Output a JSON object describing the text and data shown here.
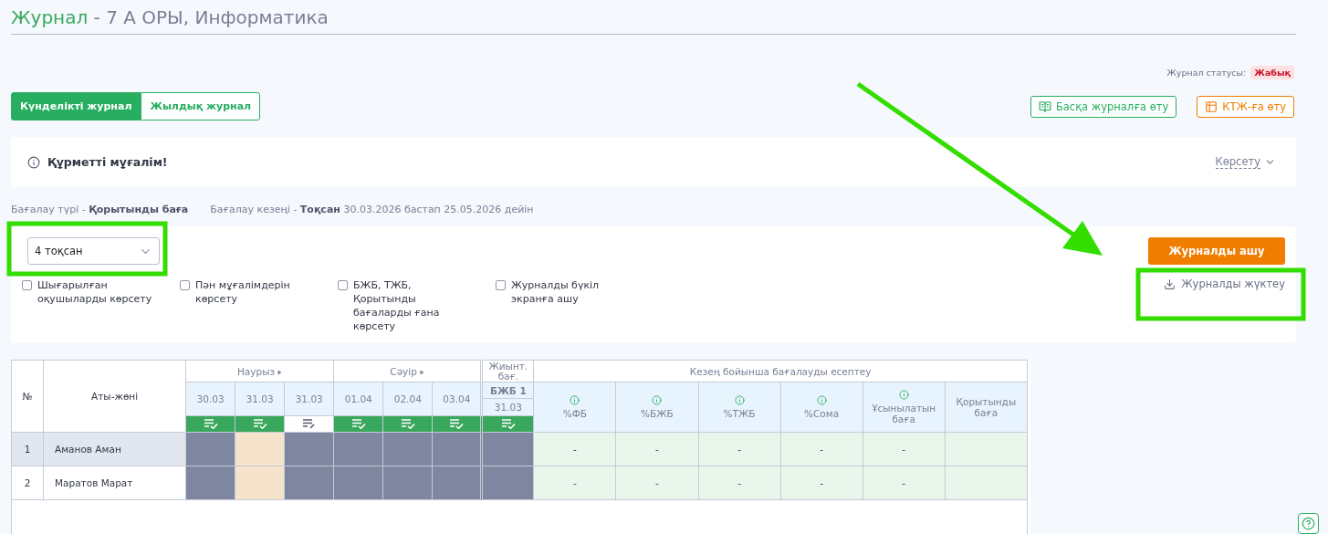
{
  "title": {
    "lead": "Журнал",
    "rest": "- 7 А ОРЫ, Информатика"
  },
  "status": {
    "label": "Журнал статусы:",
    "value": "Жабық"
  },
  "tabs": [
    {
      "label": "Күнделікті журнал",
      "selected": true
    },
    {
      "label": "Жылдық журнал",
      "selected": false
    }
  ],
  "actions": [
    {
      "label": "Басқа журналға өту",
      "kind": "journal"
    },
    {
      "label": "КТЖ-ға өту",
      "kind": "plan"
    }
  ],
  "notice": {
    "text": "Құрметті мұғалім!",
    "toggle": "Көрсету"
  },
  "assessment": [
    "Бағалау түрі - **Қорытынды баға**",
    "Бағалау кезеңі - **Тоқсан** 30.03.2026 бастап 25.05.2026 дейін"
  ],
  "quarter_select": {
    "value": "4 тоқсан"
  },
  "options": [
    {
      "label": "Шығарылған оқушыларды көрсету",
      "checked": false
    },
    {
      "label": "Пән мұғалімдерін көрсету",
      "checked": false
    },
    {
      "label": "БЖБ, ТЖБ, Қорытынды бағаларды ғана көрсету",
      "checked": false
    },
    {
      "label": "Журналды бүкіл экранға ашу",
      "checked": false
    }
  ],
  "open_button": "Журналды ашу",
  "download_link": "Журналды жүктеу",
  "table": {
    "no_header": "№",
    "name_header": "Аты-жөні",
    "months": [
      {
        "label": "Наурыз",
        "dates": [
          {
            "date": "30.03",
            "checked": true
          },
          {
            "date": "31.03",
            "checked": true
          },
          {
            "date": "31.03",
            "checked": false
          }
        ]
      },
      {
        "label": "Сәуір",
        "dates": [
          {
            "date": "01.04",
            "checked": true
          },
          {
            "date": "02.04",
            "checked": true
          },
          {
            "date": "03.04",
            "checked": true
          }
        ]
      }
    ],
    "summative": {
      "header": "Жиынт. бағ.",
      "label": "БЖБ 1",
      "date": "31.03",
      "checked": true
    },
    "calc": {
      "header": "Кезең бойынша бағалауды есептеу",
      "columns": [
        {
          "label": "%ФБ",
          "info": true
        },
        {
          "label": "%БЖБ",
          "info": true
        },
        {
          "label": "%ТЖБ",
          "info": true
        },
        {
          "label": "%Сома",
          "info": true
        },
        {
          "label": "Ұсынылатын баға",
          "info": true
        },
        {
          "label": "Қорытынды баға",
          "info": false
        }
      ]
    },
    "rows": [
      {
        "no": "1",
        "name": "Аманов Аман",
        "highlighted": true,
        "cells": [
          {
            "locked": true
          },
          {
            "locked": false
          },
          {
            "locked": true
          },
          {
            "locked": true
          },
          {
            "locked": true
          },
          {
            "locked": true
          },
          {
            "locked": true
          }
        ],
        "results": [
          "-",
          "-",
          "-",
          "-",
          "-"
        ]
      },
      {
        "no": "2",
        "name": "Маратов Марат",
        "highlighted": false,
        "cells": [
          {
            "locked": true
          },
          {
            "locked": false
          },
          {
            "locked": true
          },
          {
            "locked": true
          },
          {
            "locked": true
          },
          {
            "locked": true
          },
          {
            "locked": true
          }
        ],
        "results": [
          "-",
          "-",
          "-",
          "-",
          "-"
        ]
      }
    ]
  }
}
